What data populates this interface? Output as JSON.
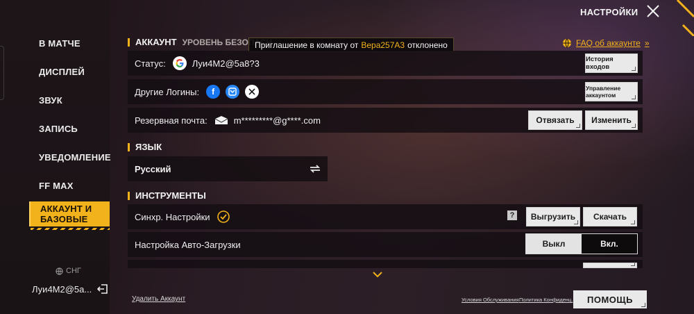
{
  "header": {
    "title": "НАСТРОЙКИ"
  },
  "sidebar": {
    "items": [
      {
        "label": "В МАТЧЕ"
      },
      {
        "label": "ДИСПЛЕЙ"
      },
      {
        "label": "ЗВУК"
      },
      {
        "label": "ЗАПИСЬ"
      },
      {
        "label": "УВЕДОМЛЕНИЕ"
      },
      {
        "label": "FF MAX"
      },
      {
        "label_line1": "АККАУНТ И",
        "label_line2": "БАЗОВЫЕ",
        "active": true
      }
    ],
    "region": "СНГ",
    "username": "Луи4М2@5а..."
  },
  "toast": {
    "prefix": "Приглашение в комнату от",
    "name": "Bepa257A3",
    "suffix": "отклонено"
  },
  "account": {
    "section_title": "АККАУНТ",
    "security_label": "УРОВЕНЬ БЕЗОПАСН",
    "faq_label": "FAQ об аккаунте",
    "status": {
      "label": "Статус:",
      "value": "Луи4М2@5а8?3",
      "history_button": "История входов"
    },
    "other_logins": {
      "label": "Другие Логины:",
      "manage_button": "Управление аккаунтом"
    },
    "backup_email": {
      "label": "Резервная почта:",
      "value": "m*********@g****.com",
      "unbind_button": "Отвязать",
      "change_button": "Изменить"
    }
  },
  "language": {
    "section_title": "ЯЗЫК",
    "current": "Русский"
  },
  "tools": {
    "section_title": "ИНСТРУМЕНТЫ",
    "sync": {
      "label": "Синхр. Настройки",
      "help": "?",
      "upload_button": "Выгрузить",
      "download_button": "Скачать"
    },
    "autoload": {
      "label": "Настройка Авто-Загрузки",
      "off_label": "Выкл",
      "on_label": "Вкл.",
      "selected": "on"
    }
  },
  "footer": {
    "delete_account": "Удалить Аккаунт",
    "terms": "Условия Обслуживания",
    "privacy": "Политика Конфиденц.",
    "help_button": "ПОМОЩЬ"
  },
  "colors": {
    "accent": "#f2b21b",
    "panel": "#140e12",
    "button": "#e9e9e9"
  },
  "icons": [
    "google-icon",
    "facebook-icon",
    "vk-icon",
    "x-icon",
    "mail-icon",
    "check-circle-icon",
    "swap-icon",
    "globe-icon",
    "logout-icon",
    "close-icon",
    "chevron-down-icon"
  ]
}
